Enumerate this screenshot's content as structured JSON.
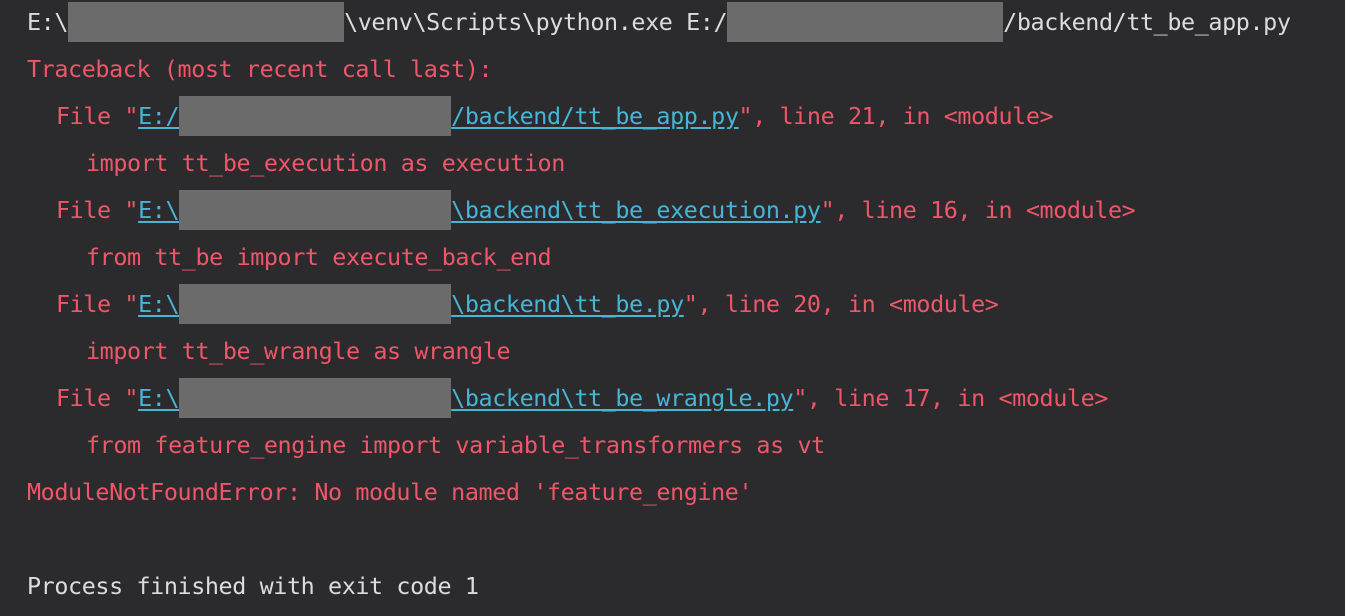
{
  "command": {
    "drive": "E:\\",
    "venv_path": "\\venv\\Scripts\\python.exe E:/",
    "script_path": "/backend/tt_be_app.py"
  },
  "traceback_header": "Traceback (most recent call last):",
  "frames": [
    {
      "prefix": "File \"",
      "path_start": "E:/",
      "path_end": "/backend/tt_be_app.py",
      "suffix": "\", line 21, in <module>",
      "code": "import tt_be_execution as execution"
    },
    {
      "prefix": "File \"",
      "path_start": "E:\\",
      "path_end": "\\backend\\tt_be_execution.py",
      "suffix": "\", line 16, in <module>",
      "code": "from tt_be import execute_back_end"
    },
    {
      "prefix": "File \"",
      "path_start": "E:\\",
      "path_end": "\\backend\\tt_be.py",
      "suffix": "\", line 20, in <module>",
      "code": "import tt_be_wrangle as wrangle"
    },
    {
      "prefix": "File \"",
      "path_start": "E:\\",
      "path_end": "\\backend\\tt_be_wrangle.py",
      "suffix": "\", line 17, in <module>",
      "code": "from feature_engine import variable_transformers as vt"
    }
  ],
  "error_message": "ModuleNotFoundError: No module named 'feature_engine'",
  "exit_message": "Process finished with exit code 1",
  "colors": {
    "background": "#2b2b2d",
    "default_text": "#dcdcdc",
    "error_text": "#f0566a",
    "link": "#46b5d6",
    "redaction": "#6b6b6b"
  }
}
